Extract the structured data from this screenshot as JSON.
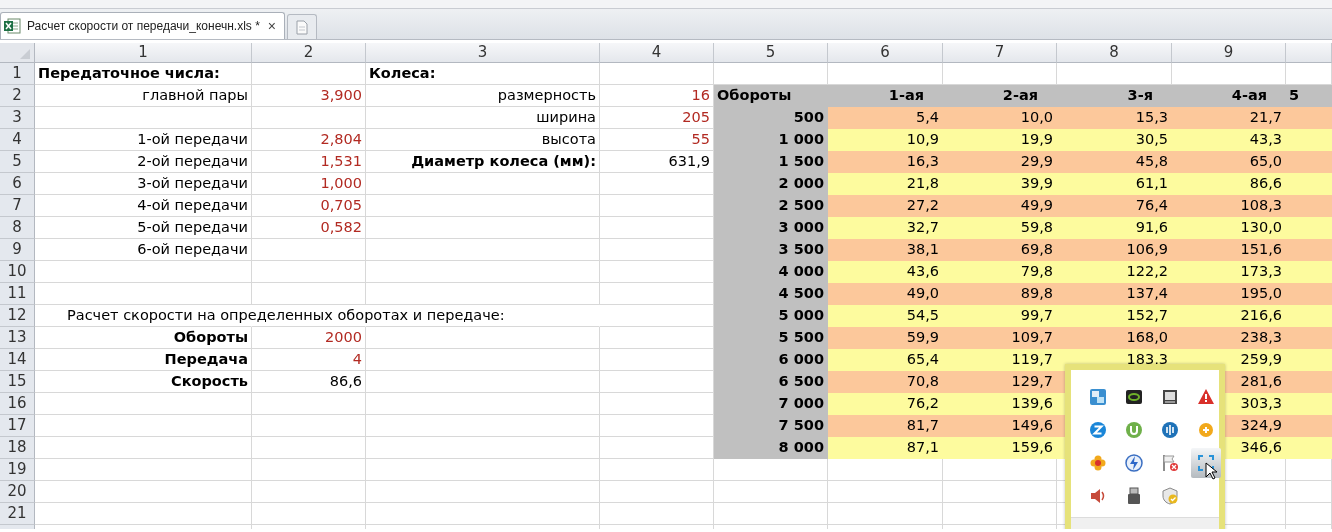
{
  "tab_bar": {
    "tabs": [
      {
        "title": "Расчет скорости от передачи_конечн.xls *",
        "close": "×",
        "selected": true
      }
    ]
  },
  "sheet": {
    "columns": [
      "1",
      "2",
      "3",
      "4",
      "5",
      "6",
      "7",
      "8",
      "9",
      ""
    ],
    "rows": [
      {
        "number": "1",
        "cells": [
          {
            "kind": "title",
            "text": "Передаточное числа:"
          },
          {
            "kind": "empty"
          },
          {
            "kind": "title",
            "text": "Колеса:"
          }
        ]
      },
      {
        "number": "2",
        "cells": [
          {
            "kind": "label",
            "text": "главной пары"
          },
          {
            "kind": "input",
            "text": "3,900"
          },
          {
            "kind": "label",
            "text": "размерность"
          },
          {
            "kind": "input",
            "text": "16"
          },
          {
            "kind": "head-left",
            "text": "Обороты"
          },
          {
            "kind": "head",
            "text": "1-ая"
          },
          {
            "kind": "head",
            "text": "2-ая"
          },
          {
            "kind": "head",
            "text": "3-я"
          },
          {
            "kind": "head",
            "text": "4-ая"
          },
          {
            "kind": "head-left",
            "text": "5"
          }
        ]
      },
      {
        "number": "3",
        "cells": [
          {
            "kind": "empty"
          },
          {
            "kind": "empty"
          },
          {
            "kind": "label",
            "text": "ширина"
          },
          {
            "kind": "input",
            "text": "205"
          },
          {
            "kind": "rpm",
            "text": "500"
          },
          {
            "kind": "band-a",
            "text": "5,4"
          },
          {
            "kind": "band-a",
            "text": "10,0"
          },
          {
            "kind": "band-a",
            "text": "15,3"
          },
          {
            "kind": "band-a",
            "text": "21,7"
          },
          {
            "kind": "band-a"
          }
        ]
      },
      {
        "number": "4",
        "cells": [
          {
            "kind": "label",
            "text": "1-ой передачи"
          },
          {
            "kind": "input",
            "text": "2,804"
          },
          {
            "kind": "label",
            "text": "высота"
          },
          {
            "kind": "input",
            "text": "55"
          },
          {
            "kind": "rpm",
            "text": "1 000"
          },
          {
            "kind": "band-b",
            "text": "10,9"
          },
          {
            "kind": "band-b",
            "text": "19,9"
          },
          {
            "kind": "band-b",
            "text": "30,5"
          },
          {
            "kind": "band-b",
            "text": "43,3"
          },
          {
            "kind": "band-b"
          }
        ]
      },
      {
        "number": "5",
        "cells": [
          {
            "kind": "label",
            "text": "2-ой передачи"
          },
          {
            "kind": "input",
            "text": "1,531"
          },
          {
            "kind": "bold-label",
            "text": "Диаметр колеса (мм):"
          },
          {
            "kind": "value",
            "text": "631,9"
          },
          {
            "kind": "rpm",
            "text": "1 500"
          },
          {
            "kind": "band-a",
            "text": "16,3"
          },
          {
            "kind": "band-a",
            "text": "29,9"
          },
          {
            "kind": "band-a",
            "text": "45,8"
          },
          {
            "kind": "band-a",
            "text": "65,0"
          },
          {
            "kind": "band-a"
          }
        ]
      },
      {
        "number": "6",
        "cells": [
          {
            "kind": "label",
            "text": "3-ой передачи"
          },
          {
            "kind": "input",
            "text": "1,000"
          },
          {
            "kind": "empty"
          },
          {
            "kind": "empty"
          },
          {
            "kind": "rpm",
            "text": "2 000"
          },
          {
            "kind": "band-b",
            "text": "21,8"
          },
          {
            "kind": "band-b",
            "text": "39,9"
          },
          {
            "kind": "band-b",
            "text": "61,1"
          },
          {
            "kind": "band-b",
            "text": "86,6"
          },
          {
            "kind": "band-b"
          }
        ]
      },
      {
        "number": "7",
        "cells": [
          {
            "kind": "label",
            "text": "4-ой передачи"
          },
          {
            "kind": "input",
            "text": "0,705"
          },
          {
            "kind": "empty"
          },
          {
            "kind": "empty"
          },
          {
            "kind": "rpm",
            "text": "2 500"
          },
          {
            "kind": "band-a",
            "text": "27,2"
          },
          {
            "kind": "band-a",
            "text": "49,9"
          },
          {
            "kind": "band-a",
            "text": "76,4"
          },
          {
            "kind": "band-a",
            "text": "108,3"
          },
          {
            "kind": "band-a"
          }
        ]
      },
      {
        "number": "8",
        "cells": [
          {
            "kind": "label",
            "text": "5-ой передачи"
          },
          {
            "kind": "input",
            "text": "0,582"
          },
          {
            "kind": "empty"
          },
          {
            "kind": "empty"
          },
          {
            "kind": "rpm",
            "text": "3 000"
          },
          {
            "kind": "band-b",
            "text": "32,7"
          },
          {
            "kind": "band-b",
            "text": "59,8"
          },
          {
            "kind": "band-b",
            "text": "91,6"
          },
          {
            "kind": "band-b",
            "text": "130,0"
          },
          {
            "kind": "band-b"
          }
        ]
      },
      {
        "number": "9",
        "cells": [
          {
            "kind": "label",
            "text": "6-ой передачи"
          },
          {
            "kind": "empty"
          },
          {
            "kind": "empty"
          },
          {
            "kind": "empty"
          },
          {
            "kind": "rpm",
            "text": "3 500"
          },
          {
            "kind": "band-a",
            "text": "38,1"
          },
          {
            "kind": "band-a",
            "text": "69,8"
          },
          {
            "kind": "band-a",
            "text": "106,9"
          },
          {
            "kind": "band-a",
            "text": "151,6"
          },
          {
            "kind": "band-a"
          }
        ]
      },
      {
        "number": "10",
        "cells": [
          {
            "kind": "empty"
          },
          {
            "kind": "empty"
          },
          {
            "kind": "empty"
          },
          {
            "kind": "empty"
          },
          {
            "kind": "rpm",
            "text": "4 000"
          },
          {
            "kind": "band-b",
            "text": "43,6"
          },
          {
            "kind": "band-b",
            "text": "79,8"
          },
          {
            "kind": "band-b",
            "text": "122,2"
          },
          {
            "kind": "band-b",
            "text": "173,3"
          },
          {
            "kind": "band-b"
          }
        ]
      },
      {
        "number": "11",
        "cells": [
          {
            "kind": "empty"
          },
          {
            "kind": "empty"
          },
          {
            "kind": "empty"
          },
          {
            "kind": "empty"
          },
          {
            "kind": "rpm",
            "text": "4 500"
          },
          {
            "kind": "band-a",
            "text": "49,0"
          },
          {
            "kind": "band-a",
            "text": "89,8"
          },
          {
            "kind": "band-a",
            "text": "137,4"
          },
          {
            "kind": "band-a",
            "text": "195,0"
          },
          {
            "kind": "band-a"
          }
        ]
      },
      {
        "number": "12",
        "cells": [
          {
            "kind": "spill",
            "text": "Расчет скорости на определенных оборотах и передаче:"
          },
          {
            "kind": "under"
          },
          {
            "kind": "under"
          },
          {
            "kind": "empty"
          },
          {
            "kind": "rpm",
            "text": "5 000"
          },
          {
            "kind": "band-b",
            "text": "54,5"
          },
          {
            "kind": "band-b",
            "text": "99,7"
          },
          {
            "kind": "band-b",
            "text": "152,7"
          },
          {
            "kind": "band-b",
            "text": "216,6"
          },
          {
            "kind": "band-b"
          }
        ]
      },
      {
        "number": "13",
        "cells": [
          {
            "kind": "bold-label",
            "text": "Обороты"
          },
          {
            "kind": "input",
            "text": "2000"
          },
          {
            "kind": "empty"
          },
          {
            "kind": "empty"
          },
          {
            "kind": "rpm",
            "text": "5 500"
          },
          {
            "kind": "band-a",
            "text": "59,9"
          },
          {
            "kind": "band-a",
            "text": "109,7"
          },
          {
            "kind": "band-a",
            "text": "168,0"
          },
          {
            "kind": "band-a",
            "text": "238,3"
          },
          {
            "kind": "band-a"
          }
        ]
      },
      {
        "number": "14",
        "cells": [
          {
            "kind": "bold-label",
            "text": "Передача"
          },
          {
            "kind": "input",
            "text": "4"
          },
          {
            "kind": "empty"
          },
          {
            "kind": "empty"
          },
          {
            "kind": "rpm",
            "text": "6 000"
          },
          {
            "kind": "band-b",
            "text": "65,4"
          },
          {
            "kind": "band-b",
            "text": "119,7"
          },
          {
            "kind": "band-b",
            "text": "183,3"
          },
          {
            "kind": "band-b",
            "text": "259,9"
          },
          {
            "kind": "band-b"
          }
        ]
      },
      {
        "number": "15",
        "cells": [
          {
            "kind": "bold-label",
            "text": "Скорость"
          },
          {
            "kind": "value",
            "text": "86,6"
          },
          {
            "kind": "empty"
          },
          {
            "kind": "empty"
          },
          {
            "kind": "rpm",
            "text": "6 500"
          },
          {
            "kind": "band-a",
            "text": "70,8"
          },
          {
            "kind": "band-a",
            "text": "129,7"
          },
          {
            "kind": "band-a"
          },
          {
            "kind": "band-a",
            "text": "281,6"
          },
          {
            "kind": "band-a"
          }
        ]
      },
      {
        "number": "16",
        "cells": [
          {
            "kind": "empty"
          },
          {
            "kind": "empty"
          },
          {
            "kind": "empty"
          },
          {
            "kind": "empty"
          },
          {
            "kind": "rpm",
            "text": "7 000"
          },
          {
            "kind": "band-b",
            "text": "76,2"
          },
          {
            "kind": "band-b",
            "text": "139,6"
          },
          {
            "kind": "band-b"
          },
          {
            "kind": "band-b",
            "text": "303,3"
          },
          {
            "kind": "band-b"
          }
        ]
      },
      {
        "number": "17",
        "cells": [
          {
            "kind": "empty"
          },
          {
            "kind": "empty"
          },
          {
            "kind": "empty"
          },
          {
            "kind": "empty"
          },
          {
            "kind": "rpm",
            "text": "7 500"
          },
          {
            "kind": "band-a",
            "text": "81,7"
          },
          {
            "kind": "band-a",
            "text": "149,6"
          },
          {
            "kind": "band-a"
          },
          {
            "kind": "band-a",
            "text": "324,9"
          },
          {
            "kind": "band-a"
          }
        ]
      },
      {
        "number": "18",
        "cells": [
          {
            "kind": "empty"
          },
          {
            "kind": "empty"
          },
          {
            "kind": "empty"
          },
          {
            "kind": "empty"
          },
          {
            "kind": "rpm",
            "text": "8 000"
          },
          {
            "kind": "band-b",
            "text": "87,1"
          },
          {
            "kind": "band-b",
            "text": "159,6"
          },
          {
            "kind": "band-b"
          },
          {
            "kind": "band-b",
            "text": "346,6"
          },
          {
            "kind": "band-b"
          }
        ]
      },
      {
        "number": "19",
        "cells": []
      },
      {
        "number": "20",
        "cells": []
      },
      {
        "number": "21",
        "cells": []
      }
    ]
  },
  "tray_popup": {
    "icons": [
      {
        "kind": "dictionary",
        "selected": false
      },
      {
        "kind": "gpu",
        "selected": false
      },
      {
        "kind": "monitor",
        "selected": false
      },
      {
        "kind": "warning",
        "selected": false
      },
      {
        "kind": "z-circle",
        "selected": false
      },
      {
        "kind": "torrent",
        "selected": false
      },
      {
        "kind": "signal",
        "selected": false
      },
      {
        "kind": "plus-circle",
        "selected": false
      },
      {
        "kind": "flower",
        "selected": false
      },
      {
        "kind": "bolt",
        "selected": false
      },
      {
        "kind": "flag-error",
        "selected": false
      },
      {
        "kind": "capture",
        "selected": true
      },
      {
        "kind": "speaker",
        "selected": false
      },
      {
        "kind": "usb",
        "selected": false
      },
      {
        "kind": "shield",
        "selected": false
      }
    ]
  }
}
